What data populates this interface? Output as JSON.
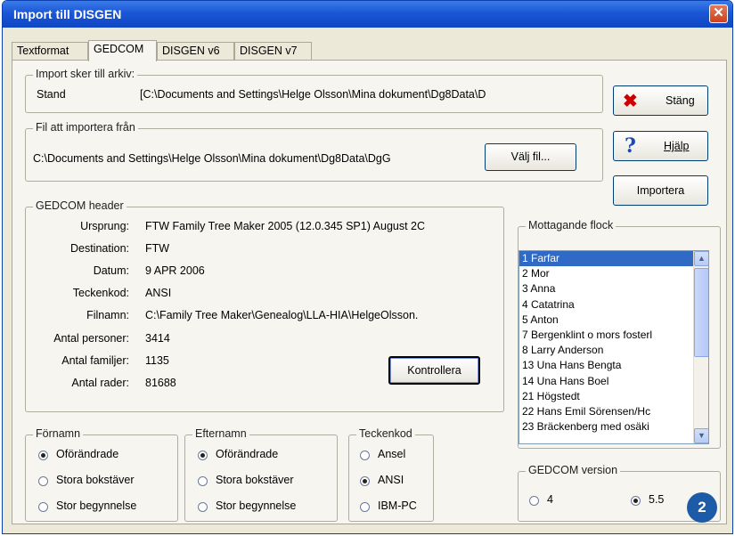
{
  "window": {
    "title": "Import till DISGEN",
    "close_glyph": "✕"
  },
  "tabs": [
    {
      "label": "Textformat",
      "active": false
    },
    {
      "label": "GEDCOM",
      "active": true
    },
    {
      "label": "DISGEN v6",
      "active": false
    },
    {
      "label": "DISGEN v7",
      "active": false
    }
  ],
  "archive": {
    "legend": "Import sker till arkiv:",
    "name": "Stand",
    "path": "[C:\\Documents and Settings\\Helge Olsson\\Mina dokument\\Dg8Data\\D"
  },
  "file": {
    "legend": "Fil att importera från",
    "path": "C:\\Documents and Settings\\Helge Olsson\\Mina dokument\\Dg8Data\\DgG",
    "choose_button": "Välj fil..."
  },
  "buttons": {
    "close": "Stäng",
    "help": "Hjälp",
    "import": "Importera",
    "check": "Kontrollera"
  },
  "icons": {
    "close": "red-x-icon",
    "help": "question-mark-icon"
  },
  "header": {
    "legend": "GEDCOM header",
    "rows": [
      {
        "label": "Ursprung:",
        "value": "FTW Family Tree Maker 2005 (12.0.345 SP1) August 2C"
      },
      {
        "label": "Destination:",
        "value": "FTW"
      },
      {
        "label": "Datum:",
        "value": "9 APR 2006"
      },
      {
        "label": "Teckenkod:",
        "value": "ANSI"
      },
      {
        "label": "Filnamn:",
        "value": "C:\\Family Tree Maker\\Genealog\\LLA-HIA\\HelgeOlsson."
      },
      {
        "label": "Antal personer:",
        "value": "3414"
      },
      {
        "label": "Antal familjer:",
        "value": "1135"
      },
      {
        "label": "Antal rader:",
        "value": "81688"
      }
    ]
  },
  "receiving": {
    "legend": "Mottagande flock",
    "items": [
      "1 Farfar",
      "2 Mor",
      "3 Anna",
      "4 Catatrina",
      "5 Anton",
      "7 Bergenklint o mors fosterl",
      "8 Larry Anderson",
      "13 Una Hans Bengta",
      "14 Una Hans Boel",
      "21 Högstedt",
      "22 Hans Emil Sörensen/Hc",
      "23 Bräckenberg med osäki"
    ],
    "selected_index": 0
  },
  "firstname": {
    "legend": "Förnamn",
    "options": [
      "Oförändrade",
      "Stora bokstäver",
      "Stor begynnelse"
    ],
    "selected": 0
  },
  "lastname": {
    "legend": "Efternamn",
    "options": [
      "Oförändrade",
      "Stora bokstäver",
      "Stor begynnelse"
    ],
    "selected": 0
  },
  "charset": {
    "legend": "Teckenkod",
    "options": [
      "Ansel",
      "ANSI",
      "IBM-PC"
    ],
    "selected": 1
  },
  "version": {
    "legend": "GEDCOM version",
    "options": [
      "4",
      "5.5"
    ],
    "selected": 1
  },
  "badge": "2"
}
